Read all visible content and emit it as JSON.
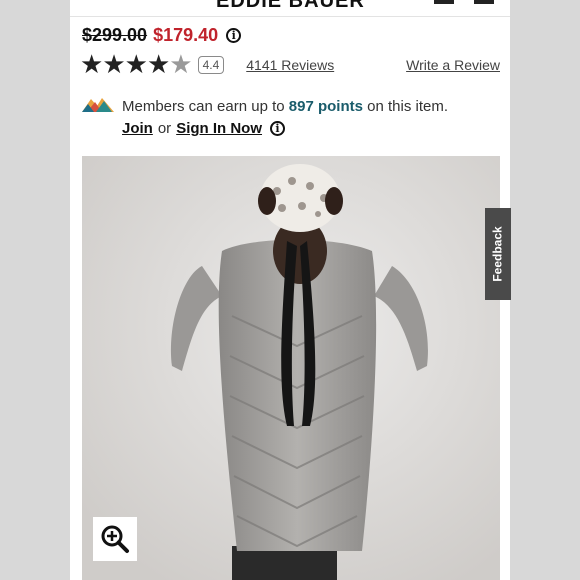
{
  "header": {
    "logo_fragment": "EDDIE BAUER"
  },
  "pricing": {
    "original_price": "$299.00",
    "sale_price": "$179.40",
    "info_icon": "info-icon"
  },
  "rating": {
    "stars_filled": 4,
    "stars_total": 5,
    "score_badge": "4.4",
    "reviews_link": "4141 Reviews",
    "write_review_link": "Write a Review"
  },
  "members": {
    "icon": "mountain-logo-icon",
    "text_before": "Members can earn up to",
    "points": "897 points",
    "text_after": "on this item.",
    "join_link": "Join",
    "or_text": "or",
    "signin_link": "Sign In Now"
  },
  "product_image": {
    "zoom_icon": "zoom-in-icon"
  },
  "feedback_tab": {
    "label": "Feedback"
  },
  "colors": {
    "sale_red": "#c0232c",
    "points_teal": "#1a5c6b",
    "feedback_bg": "#4a4a4a"
  }
}
